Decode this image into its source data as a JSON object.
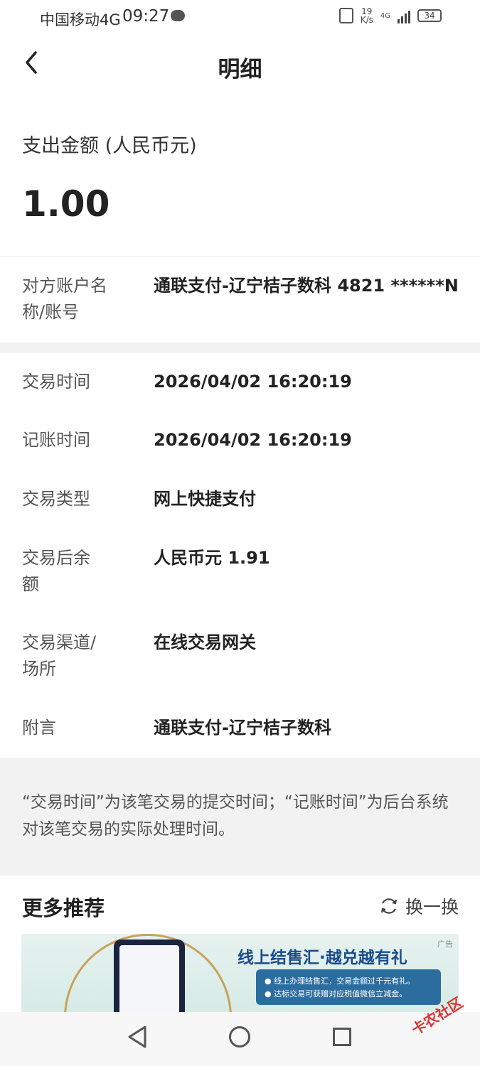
{
  "status_bar": {
    "carrier": "中国移动4G",
    "time": "09:27",
    "net_speed_value": "19",
    "net_speed_unit": "K/s",
    "network": "4G",
    "battery": "34"
  },
  "nav": {
    "title": "明细"
  },
  "amount": {
    "label": "支出金额 (人民币元)",
    "value": "1.00"
  },
  "counterparty": {
    "label": "对方账户名称/账号",
    "value": "通联支付-辽宁桔子数科 4821 ******N"
  },
  "details": [
    {
      "label": "交易时间",
      "value": "2026/04/02 16:20:19"
    },
    {
      "label": "记账时间",
      "value": "2026/04/02 16:20:19"
    },
    {
      "label": "交易类型",
      "value": "网上快捷支付"
    },
    {
      "label": "交易后余额",
      "value": "人民币元 1.91"
    },
    {
      "label": "交易渠道/场所",
      "value": "在线交易网关"
    },
    {
      "label": "附言",
      "value": "通联支付-辽宁桔子数科"
    }
  ],
  "note": "“交易时间”为该笔交易的提交时间；“记账时间”为后台系统对该笔交易的实际处理时间。",
  "recommend": {
    "title": "更多推荐",
    "refresh_label": "换一换",
    "banner": {
      "headline": "线上结售汇·越兑越有礼",
      "line1": "● 线上办理结售汇，交易金额过千元有礼。",
      "line2": "● 达标交易可获赠对应税值微信立减金。",
      "ad_tag": "广告"
    }
  },
  "watermark": "卡农社区",
  "colors": {
    "accent": "#222222",
    "band": "#f2f2f2",
    "label": "#555555"
  }
}
